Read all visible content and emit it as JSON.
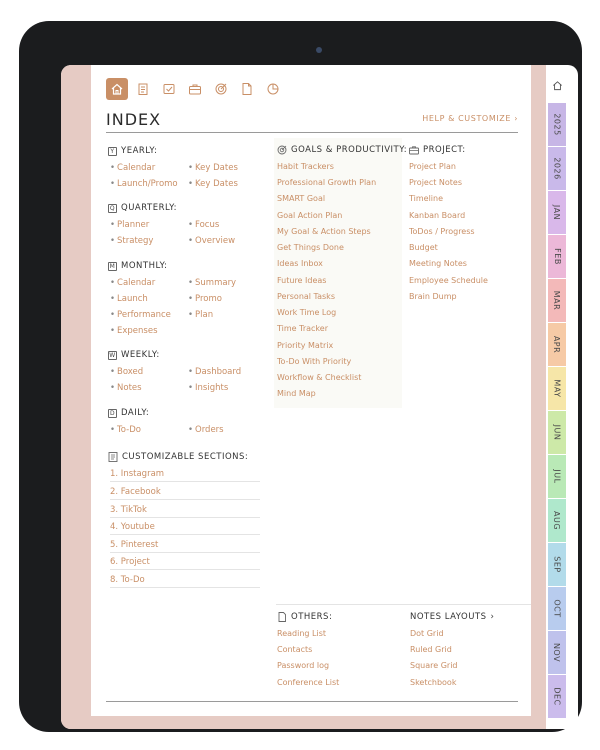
{
  "colors": {
    "accent": "#c98f66",
    "frame": "#e6cbc4"
  },
  "toolbar": {
    "icons": [
      "home-icon",
      "notes-icon",
      "checkbox-icon",
      "briefcase-icon",
      "target-icon",
      "document-icon",
      "pie-chart-icon"
    ]
  },
  "header": {
    "title": "INDEX",
    "help": "HELP & CUSTOMIZE"
  },
  "yearly": {
    "title": "YEARLY:",
    "icon_letter": "Y",
    "items": [
      "Calendar",
      "Key Dates",
      "Launch/Promo",
      "Key Dates"
    ]
  },
  "quarterly": {
    "title": "QUARTERLY:",
    "icon_letter": "Q",
    "items": [
      "Planner",
      "Focus",
      "Strategy",
      "Overview"
    ]
  },
  "monthly": {
    "title": "MONTHLY:",
    "icon_letter": "M",
    "items": [
      "Calendar",
      "Summary",
      "Launch",
      "Promo",
      "Performance",
      "Plan",
      "Expenses"
    ]
  },
  "weekly": {
    "title": "WEEKLY:",
    "icon_letter": "W",
    "items": [
      "Boxed",
      "Dashboard",
      "Notes",
      "Insights"
    ]
  },
  "daily": {
    "title": "DAILY:",
    "icon_letter": "D",
    "items": [
      "To-Do",
      "Orders"
    ]
  },
  "custom": {
    "title": "CUSTOMIZABLE SECTIONS:",
    "items": [
      "1. Instagram",
      "2. Facebook",
      "3. TikTok",
      "4. Youtube",
      "5. Pinterest",
      "6. Project",
      "8. To-Do"
    ]
  },
  "goals": {
    "title": "GOALS & PRODUCTIVITY:",
    "items": [
      "Habit Trackers",
      "Professional Growth Plan",
      "SMART Goal",
      "Goal Action Plan",
      "My Goal & Action Steps",
      "Get Things Done",
      "Ideas Inbox",
      "Future Ideas",
      "Personal Tasks",
      "Work Time Log",
      "Time Tracker",
      "Priority Matrix",
      "To-Do With Priority",
      "Workflow & Checklist",
      "Mind Map"
    ]
  },
  "project": {
    "title": "PROJECT:",
    "items": [
      "Project Plan",
      "Project Notes",
      "Timeline",
      "Kanban Board",
      "ToDos / Progress",
      "Budget",
      "Meeting Notes",
      "Employee Schedule",
      "Brain Dump"
    ]
  },
  "others": {
    "title": "OTHERS:",
    "items": [
      "Reading List",
      "Contacts",
      "Password log",
      "Conference List"
    ]
  },
  "notes": {
    "title": "NOTES LAYOUTS",
    "items": [
      "Dot Grid",
      "Ruled Grid",
      "Square Grid",
      "Sketchbook"
    ]
  },
  "tabs": [
    {
      "label": "2025",
      "color": "#c7b6e6"
    },
    {
      "label": "2026",
      "color": "#c9b9ea"
    },
    {
      "label": "JAN",
      "color": "#d9b8ea"
    },
    {
      "label": "FEB",
      "color": "#ecb8d8"
    },
    {
      "label": "MAR",
      "color": "#f3b9b9"
    },
    {
      "label": "APR",
      "color": "#f6caa6"
    },
    {
      "label": "MAY",
      "color": "#f6e6a8"
    },
    {
      "label": "JUN",
      "color": "#cde9a8"
    },
    {
      "label": "JUL",
      "color": "#b9e9b6"
    },
    {
      "label": "AUG",
      "color": "#afe8cc"
    },
    {
      "label": "SEP",
      "color": "#b2dbea"
    },
    {
      "label": "OCT",
      "color": "#b8ccee"
    },
    {
      "label": "NOV",
      "color": "#bfc2ec"
    },
    {
      "label": "DEC",
      "color": "#cbbcec"
    }
  ]
}
